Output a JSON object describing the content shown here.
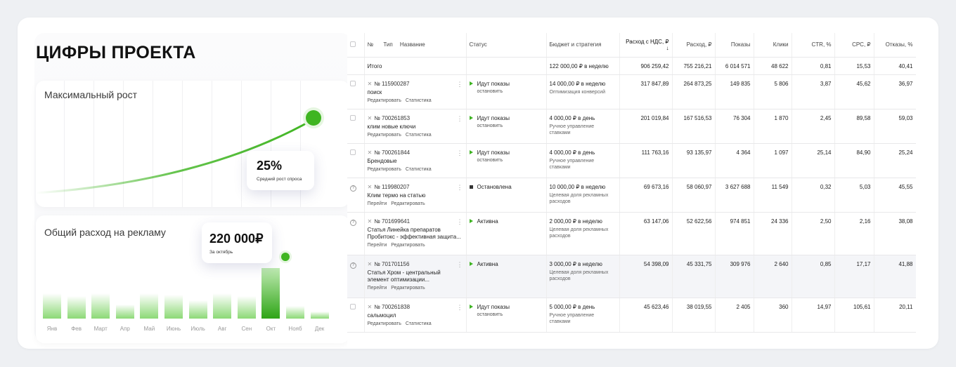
{
  "left": {
    "title": "ЦИФРЫ ПРОЕКТА",
    "growth_card": {
      "heading": "Максимальный рост",
      "badge_value": "25%",
      "badge_caption": "Средний рост спроса"
    },
    "spend_card": {
      "heading": "Общий расход на рекламу",
      "badge_value": "220 000₽",
      "badge_caption": "За октябрь",
      "months": [
        "Янв",
        "Фев",
        "Март",
        "Апр",
        "Май",
        "Июнь",
        "Июль",
        "Авг",
        "Сен",
        "Окт",
        "Нояб",
        "Дек"
      ],
      "bar_levels": [
        0.36,
        0.32,
        0.36,
        0.2,
        0.36,
        0.34,
        0.26,
        0.36,
        0.32,
        0.72,
        0.18,
        0.1
      ],
      "highlight_index": 9
    },
    "accent_color": "#3fb521"
  },
  "table": {
    "headers": {
      "num": "№",
      "type": "Тип",
      "name": "Название",
      "status": "Статус",
      "budget": "Бюджет и стратегия",
      "spend_vat": "Расход с НДС, ₽ ↓",
      "spend": "Расход, ₽",
      "impressions": "Показы",
      "clicks": "Клики",
      "ctr": "CTR, %",
      "cpc": "CPC, ₽",
      "bounces": "Отказы, %"
    },
    "total": {
      "label": "Итого",
      "budget": "122 000,00 ₽ в неделю",
      "spend_vat": "906 259,42",
      "spend": "755 216,21",
      "impressions": "6 014 571",
      "clicks": "48 622",
      "ctr": "0,81",
      "cpc": "15,53",
      "bounces": "40,41"
    },
    "rows": [
      {
        "id": "№ 115900287",
        "name_lines": [
          "поиск"
        ],
        "links": [
          "Редактировать",
          "Статистика"
        ],
        "status": "Идут показы",
        "status_icon": "play",
        "status_sub": "остановить",
        "budget": "14 000,00 ₽ в неделю",
        "budget_sub": [
          "Оптимизация конверсий"
        ],
        "spend_vat": "317 847,89",
        "spend": "264 873,25",
        "impressions": "149 835",
        "clicks": "5 806",
        "ctr": "3,87",
        "cpc": "45,62",
        "bounces": "36,97",
        "left_icon": "checkbox"
      },
      {
        "id": "№ 700261853",
        "name_lines": [
          "клим новые ключи"
        ],
        "links": [
          "Редактировать",
          "Статистика"
        ],
        "status": "Идут показы",
        "status_icon": "play",
        "status_sub": "остановить",
        "budget": "4 000,00 ₽ в день",
        "budget_sub": [
          "Ручное управление",
          "ставками"
        ],
        "spend_vat": "201 019,84",
        "spend": "167 516,53",
        "impressions": "76 304",
        "clicks": "1 870",
        "ctr": "2,45",
        "cpc": "89,58",
        "bounces": "59,03",
        "left_icon": "checkbox"
      },
      {
        "id": "№ 700261844",
        "name_lines": [
          "Брендовые"
        ],
        "links": [
          "Редактировать",
          "Статистика"
        ],
        "status": "Идут показы",
        "status_icon": "play",
        "status_sub": "остановить",
        "budget": "4 000,00 ₽ в день",
        "budget_sub": [
          "Ручное управление",
          "ставками"
        ],
        "spend_vat": "111 763,16",
        "spend": "93 135,97",
        "impressions": "4 364",
        "clicks": "1 097",
        "ctr": "25,14",
        "cpc": "84,90",
        "bounces": "25,24",
        "left_icon": "checkbox"
      },
      {
        "id": "№ 119980207",
        "name_lines": [
          "Клим термо на статью"
        ],
        "links": [
          "Перейти",
          "Редактировать"
        ],
        "status": "Остановлена",
        "status_icon": "stop",
        "status_sub": "",
        "budget": "10 000,00 ₽ в неделю",
        "budget_sub": [
          "Целевая доля рекламных",
          "расходов"
        ],
        "spend_vat": "69 673,16",
        "spend": "58 060,97",
        "impressions": "3 627 688",
        "clicks": "11 549",
        "ctr": "0,32",
        "cpc": "5,03",
        "bounces": "45,55",
        "left_icon": "question"
      },
      {
        "id": "№ 701699641",
        "name_lines": [
          "Статья Линейка препаратов",
          "Пробитокс - эффективная защита..."
        ],
        "links": [
          "Перейти",
          "Редактировать"
        ],
        "status": "Активна",
        "status_icon": "play",
        "status_sub": "",
        "budget": "2 000,00 ₽ в неделю",
        "budget_sub": [
          "Целевая доля рекламных",
          "расходов"
        ],
        "spend_vat": "63 147,06",
        "spend": "52 622,56",
        "impressions": "974 851",
        "clicks": "24 336",
        "ctr": "2,50",
        "cpc": "2,16",
        "bounces": "38,08",
        "left_icon": "question"
      },
      {
        "id": "№ 701701156",
        "name_lines": [
          "Статья Хром - центральный",
          "элемент оптимизации..."
        ],
        "links": [
          "Перейти",
          "Редактировать"
        ],
        "status": "Активна",
        "status_icon": "play",
        "status_sub": "",
        "budget": "3 000,00 ₽ в неделю",
        "budget_sub": [
          "Целевая доля рекламных",
          "расходов"
        ],
        "spend_vat": "54 398,09",
        "spend": "45 331,75",
        "impressions": "309 976",
        "clicks": "2 640",
        "ctr": "0,85",
        "cpc": "17,17",
        "bounces": "41,88",
        "left_icon": "question",
        "highlight": true
      },
      {
        "id": "№ 700261838",
        "name_lines": [
          "сальмоцил"
        ],
        "links": [
          "Редактировать",
          "Статистика"
        ],
        "status": "Идут показы",
        "status_icon": "play",
        "status_sub": "остановить",
        "budget": "5 000,00 ₽ в день",
        "budget_sub": [
          "Ручное управление",
          "ставками"
        ],
        "spend_vat": "45 623,46",
        "spend": "38 019,55",
        "impressions": "2 405",
        "clicks": "360",
        "ctr": "14,97",
        "cpc": "105,61",
        "bounces": "20,11",
        "left_icon": "checkbox"
      }
    ]
  }
}
